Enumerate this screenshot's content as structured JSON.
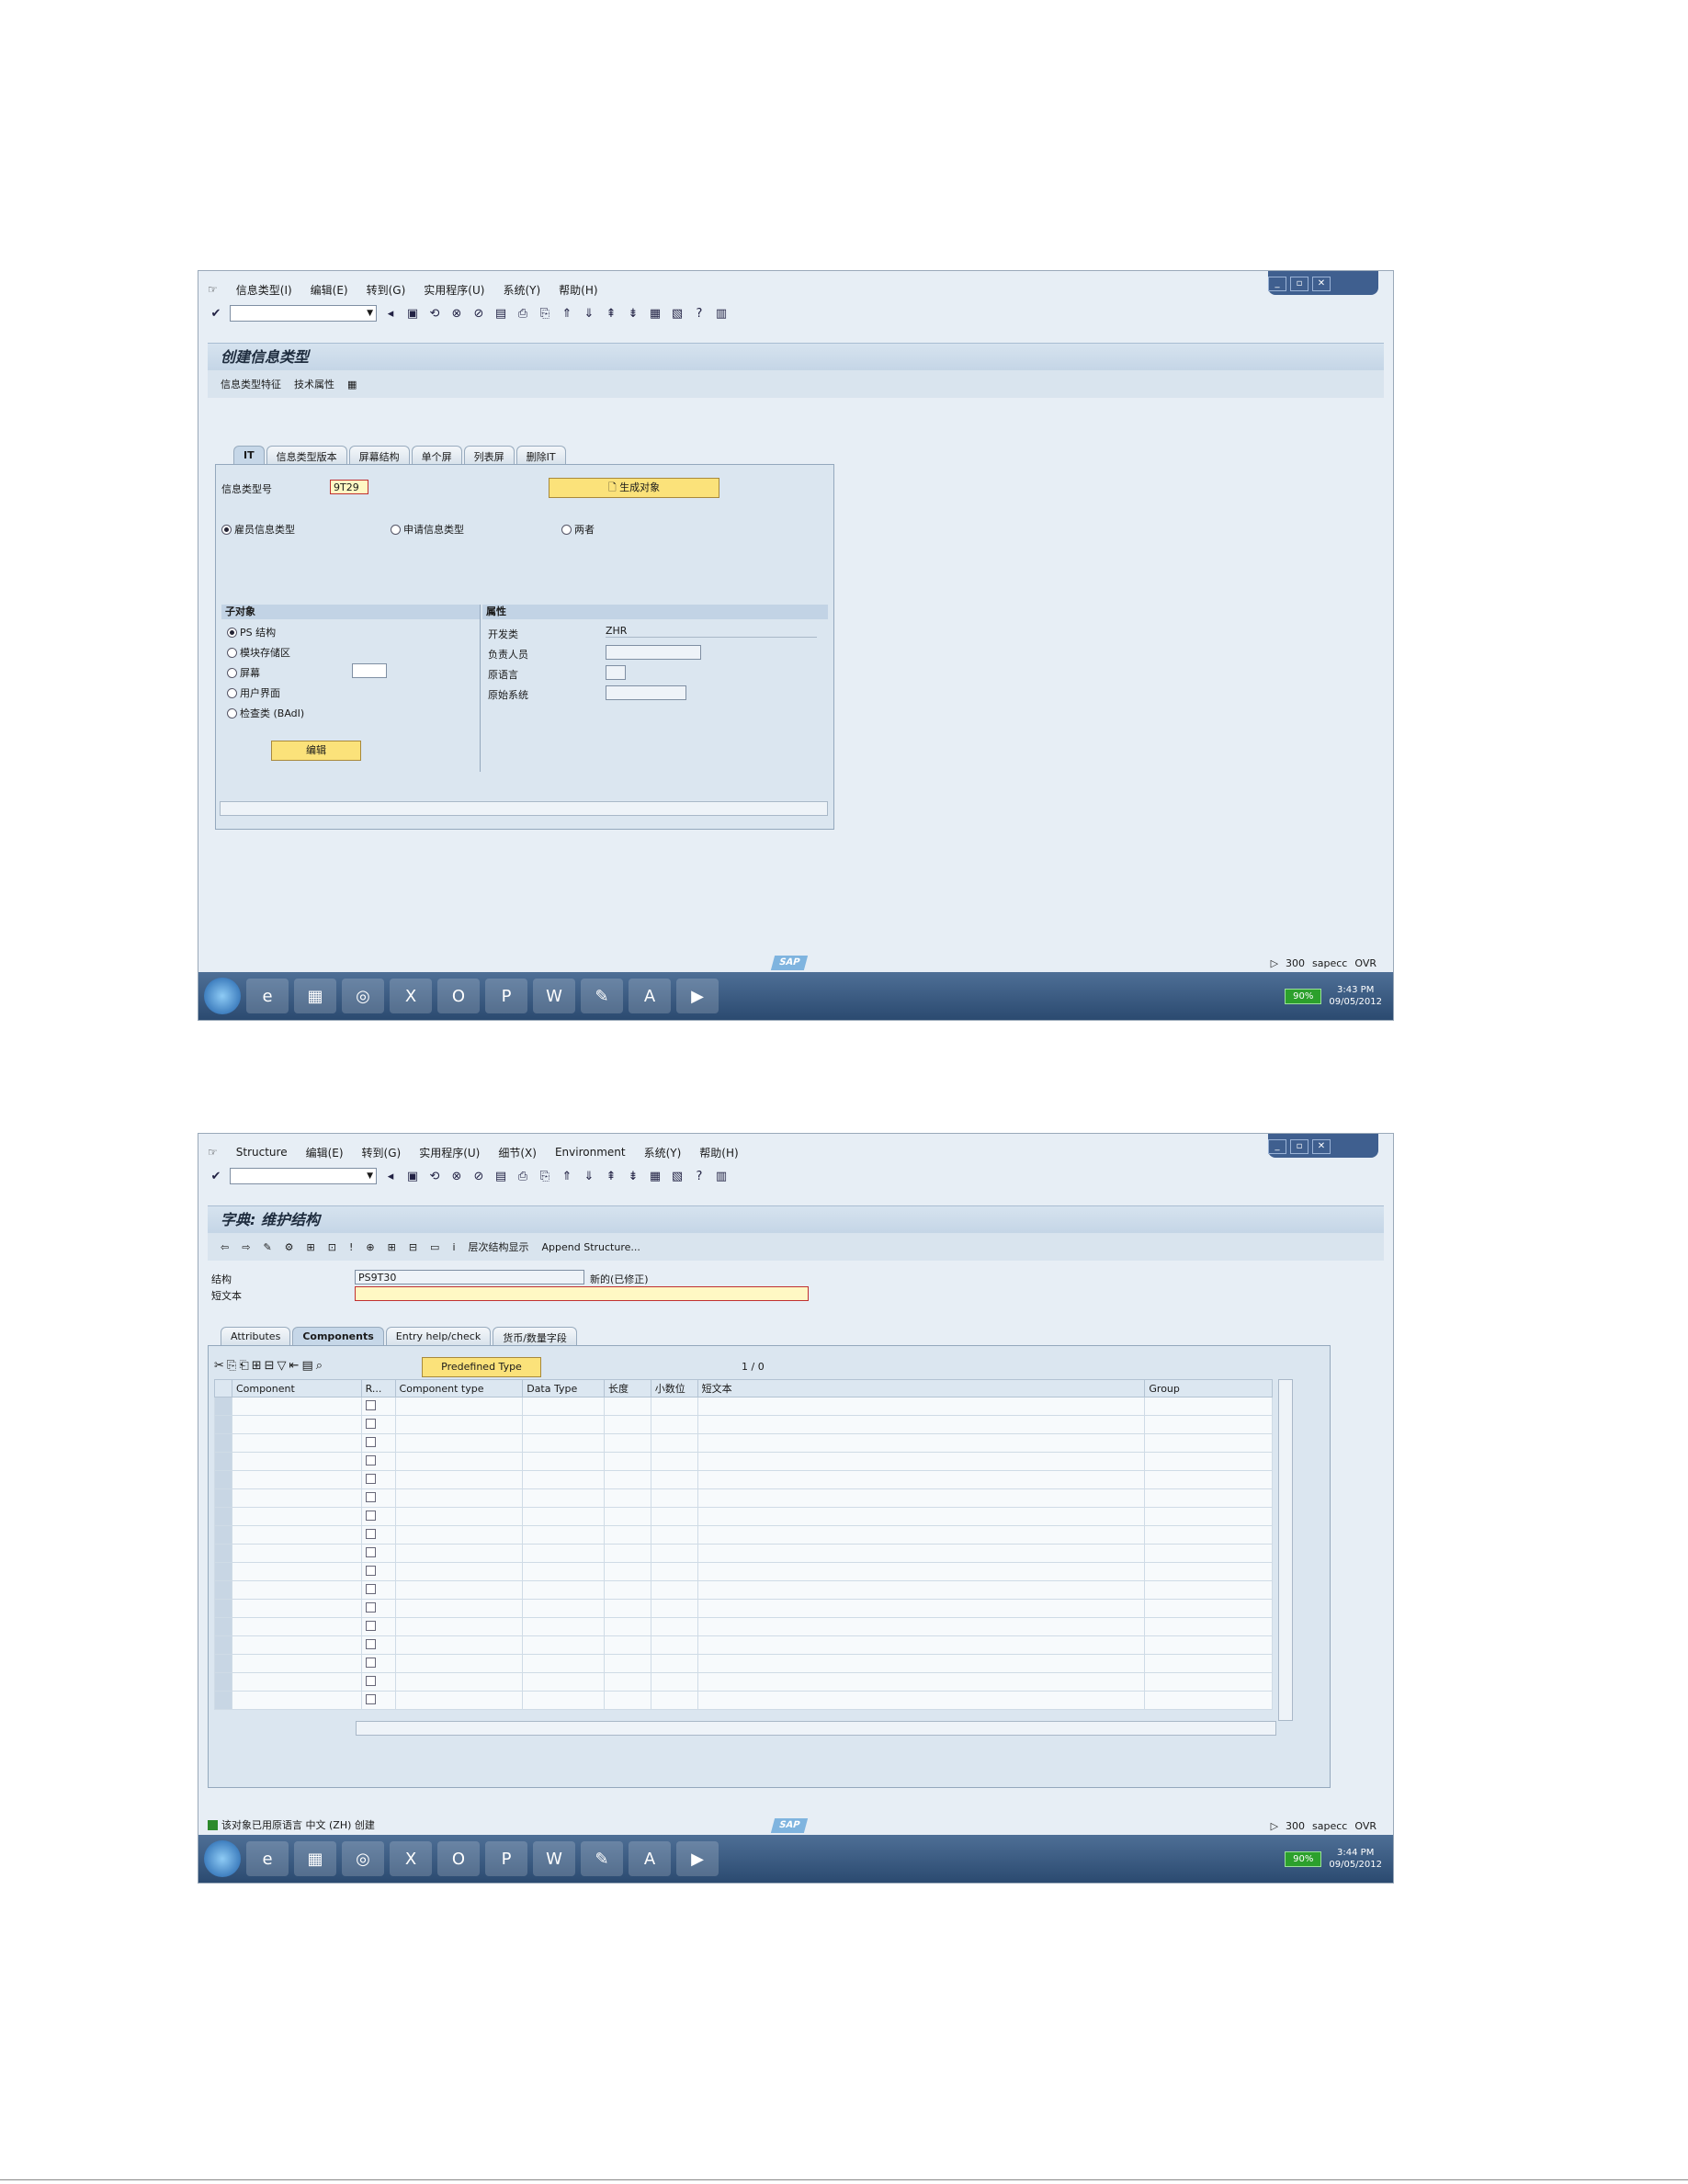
{
  "common": {
    "window_buttons": [
      "_",
      "▫",
      "✕"
    ],
    "toolbar_icons": [
      "✔",
      "◂",
      "▣",
      "⟲",
      "⊗",
      "⊘",
      "▤",
      "⎙",
      "⎘",
      "⇑",
      "⇓",
      "⇞",
      "⇟",
      "▦",
      "▧",
      "?",
      "▥"
    ],
    "sap_logo": "SAP",
    "taskbar_apps": [
      "e",
      "▦",
      "◎",
      "X",
      "O",
      "P",
      "W",
      "✎",
      "A",
      "▶"
    ],
    "battery": "90%"
  },
  "shot1": {
    "menu": [
      "信息类型(I)",
      "编辑(E)",
      "转到(G)",
      "实用程序(U)",
      "系统(Y)",
      "帮助(H)"
    ],
    "title": "创建信息类型",
    "app_toolbar": [
      "信息类型特征",
      "技术属性",
      "▦"
    ],
    "tabs": [
      "IT",
      "信息类型版本",
      "屏幕结构",
      "单个屏",
      "列表屏",
      "删除IT"
    ],
    "infotype_label": "信息类型号",
    "infotype_value": "9T29",
    "generate_button": "生成对象",
    "radio_employee": "雇员信息类型",
    "radio_applicant": "申请信息类型",
    "radio_both": "两者",
    "subobjects_header": "子对象",
    "subobjects": [
      "PS 结构",
      "模块存储区",
      "屏幕",
      "用户界面",
      "检查类 (BAdI)"
    ],
    "edit_button": "编辑",
    "attributes_header": "属性",
    "attr_labels": [
      "开发类",
      "负责人员",
      "原语言",
      "原始系统"
    ],
    "attr_values": [
      "ZHR",
      "",
      "",
      ""
    ],
    "status_right": [
      "300",
      "sapecc",
      "OVR"
    ],
    "clock_time": "3:43 PM",
    "clock_date": "09/05/2012"
  },
  "shot2": {
    "menu": [
      "Structure",
      "编辑(E)",
      "转到(G)",
      "实用程序(U)",
      "细节(X)",
      "Environment",
      "系统(Y)",
      "帮助(H)"
    ],
    "title": "字典: 维护结构",
    "app_toolbar": [
      "⇦",
      "⇨",
      "✎",
      "⚙",
      "⊞",
      "⊡",
      "!",
      "⊕",
      "⊞",
      "⊟",
      "▭",
      "i",
      "层次结构显示",
      "Append Structure..."
    ],
    "struct_label": "结构",
    "struct_value": "PS9T30",
    "struct_status": "新的(已修正)",
    "shorttext_label": "短文本",
    "shorttext_value": "",
    "tabs": [
      "Attributes",
      "Components",
      "Entry help/check",
      "货币/数量字段"
    ],
    "predefined_type_button": "Predefined Type",
    "counter": "1 / 0",
    "columns": [
      "Component",
      "R...",
      "Component type",
      "Data Type",
      "长度",
      "小数位",
      "短文本",
      "Group"
    ],
    "row_count": 17,
    "status_message": "该对象已用原语言 中文 (ZH) 创建",
    "status_right": [
      "300",
      "sapecc",
      "OVR"
    ],
    "clock_time": "3:44 PM",
    "clock_date": "09/05/2012"
  }
}
